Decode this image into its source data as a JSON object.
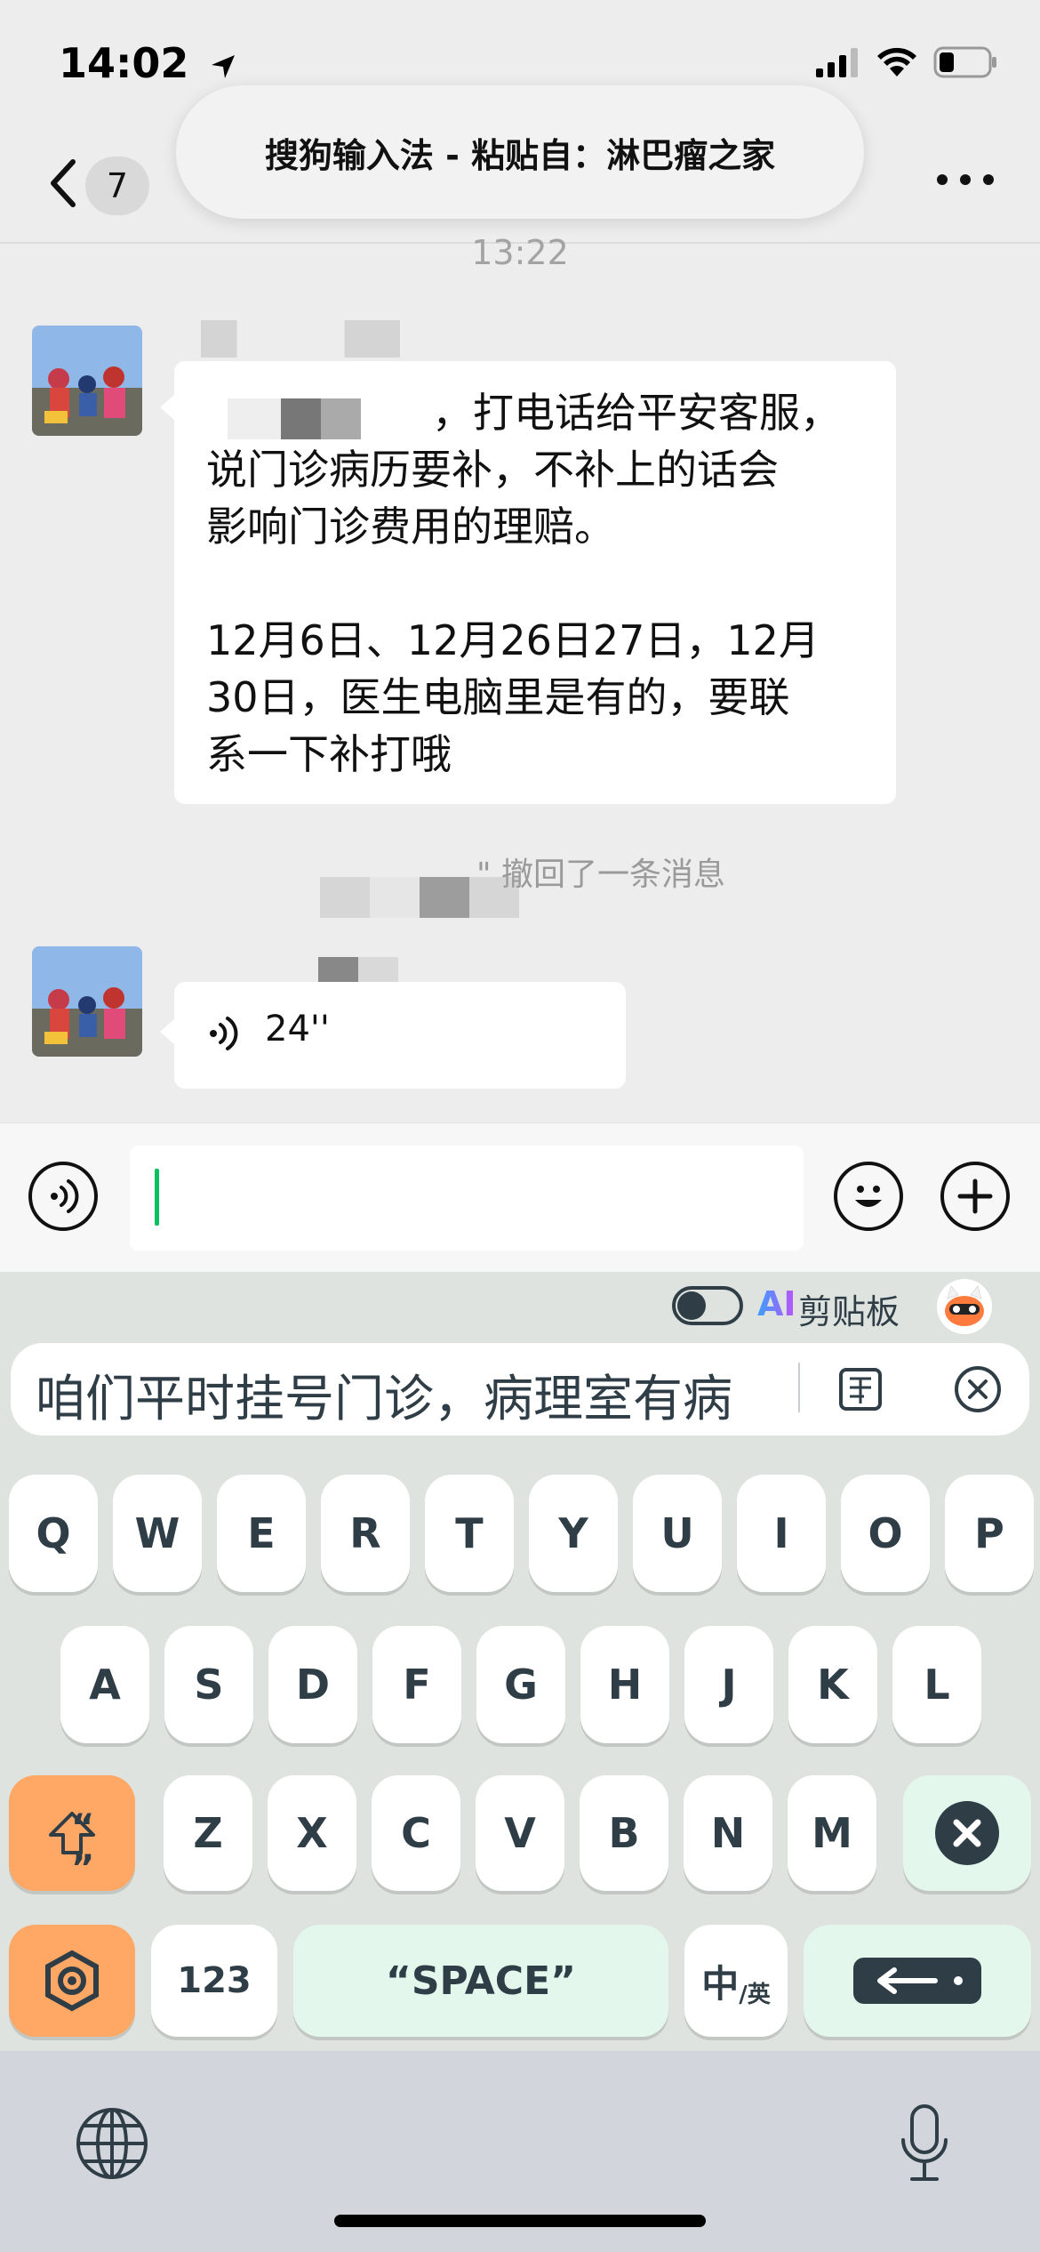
{
  "status_bar": {
    "time": "14:02"
  },
  "toast": {
    "text": "搜狗输入法 - 粘贴自：淋巴瘤之家"
  },
  "nav": {
    "unread_count": "7"
  },
  "chat": {
    "timestamp": "13:22",
    "message1": {
      "text": "，打电话给平安客服，\n说门诊病历要补，不补上的话会\n影响门诊费用的理赔。\n\n12月6日、12月26日27日，12月\n30日，医生电脑里是有的，要联\n系一下补打哦"
    },
    "recall_notice": "\" 撤回了一条消息",
    "voice_message": {
      "duration": "24''"
    }
  },
  "keyboard": {
    "ai_label": "AI",
    "clipboard_label": "剪贴板",
    "candidate_text": "咱们平时挂号门诊，病理室有病",
    "rows": [
      [
        "Q",
        "W",
        "E",
        "R",
        "T",
        "Y",
        "U",
        "I",
        "O",
        "P"
      ],
      [
        "A",
        "S",
        "D",
        "F",
        "G",
        "H",
        "J",
        "K",
        "L"
      ],
      [
        "Z",
        "X",
        "C",
        "V",
        "B",
        "N",
        "M"
      ]
    ],
    "shift_label": "“ ”",
    "num_label": "123",
    "space_label": "“SPACE”",
    "lang_label_main": "中",
    "lang_label_sub": "/英",
    "colors": {
      "accent_orange": "#ffa764",
      "mint": "#e3f7ec",
      "key_text": "#2f3d47",
      "wechat_green": "#07c160"
    }
  }
}
